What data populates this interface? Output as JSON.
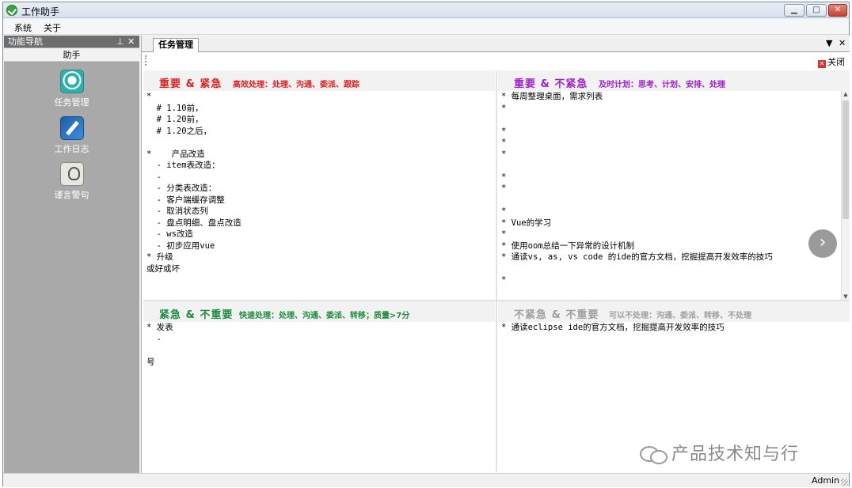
{
  "window": {
    "title": "工作助手",
    "min_label": "▁",
    "max_label": "□",
    "close_label": "✕"
  },
  "menu": {
    "items": [
      "系统",
      "关于"
    ]
  },
  "nav": {
    "pane_title": "功能导航",
    "pin_glyph": "⊥",
    "close_glyph": "✕",
    "group_title": "助手",
    "items": [
      {
        "label": "任务管理",
        "icon": "task-icon"
      },
      {
        "label": "工作日志",
        "icon": "pen-icon"
      },
      {
        "label": "谨言警句",
        "icon": "bulb-icon"
      }
    ]
  },
  "document": {
    "tab_label": "任务管理",
    "dropdown_glyph": "▼",
    "close_glyph": "✕",
    "toolbar_close_label": "关闭",
    "toolbar_close_icon_glyph": "✕"
  },
  "quadrants": {
    "q1": {
      "title": "重要 & 紧急",
      "subtitle": "高效处理：处理、沟通、委派、跟踪",
      "color": "#e02020",
      "lines": [
        "*",
        "  # 1.10前，",
        "  # 1.20前，",
        "  # 1.20之后，",
        "",
        "*    产品改造",
        "  - item表改造：",
        "  -",
        "  - 分类表改造：",
        "  - 客户端缓存调整",
        "  - 取消状态列",
        "  - 盘点明细、盘点改造",
        "  - ws改造",
        "  - 初步应用vue",
        "* 升级",
        "或好或坏"
      ]
    },
    "q2": {
      "title": "重要 & 不紧急",
      "subtitle": "及时计划：思考、计划、安排、处理",
      "color": "#a020d0",
      "lines": [
        "* 每周整理桌面，需求列表",
        "*",
        "",
        "*",
        "*",
        "*",
        "",
        "*",
        "*",
        "",
        "*",
        "* Vue的学习",
        "*",
        "* 使用oom总结一下异常的设计机制",
        "* 通读vs, as, vs code 的ide的官方文档，挖掘提高开发效率的技巧",
        "",
        "*"
      ]
    },
    "q3": {
      "title": "紧急 & 不重要",
      "subtitle": "快速处理：处理、沟通、委派、转移；质量>7分",
      "color": "#1c8c3c",
      "lines": [
        "* 发表",
        "  -",
        "",
        "号"
      ]
    },
    "q4": {
      "title": "不紧急 & 不重要",
      "subtitle": "可以不处理：沟通、委派、转移、不处理",
      "color": "#9e9e9e",
      "lines": [
        "* 通读eclipse ide的官方文档，挖掘提高开发效率的技巧",
        "",
        ""
      ]
    }
  },
  "next_glyph": "›",
  "watermark": "产品技术知与行",
  "status": {
    "user": "Admin"
  }
}
